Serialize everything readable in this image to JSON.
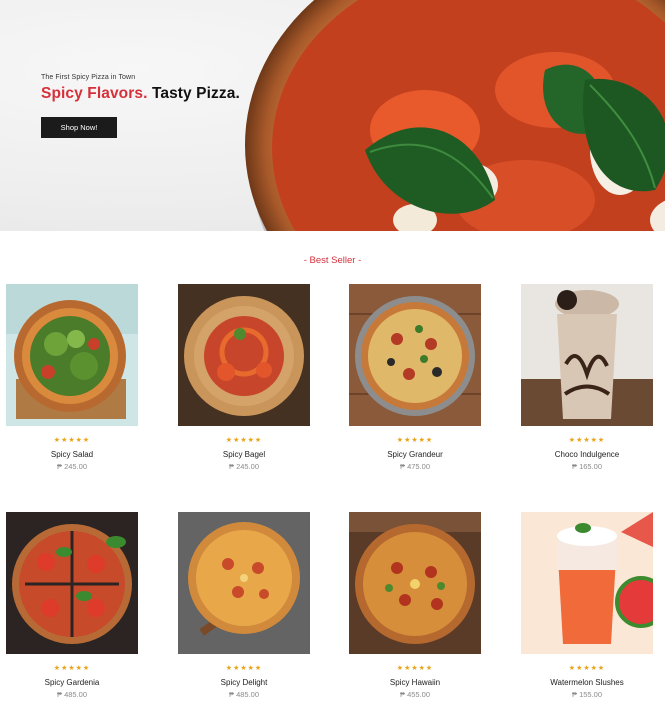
{
  "hero": {
    "tagline": "The First Spicy Pizza in Town",
    "headline_accent": "Spicy Flavors.",
    "headline_rest": "Tasty Pizza.",
    "cta_label": "Shop Now!"
  },
  "section": {
    "title": "- Best Seller -"
  },
  "products": [
    {
      "name": "Spicy Salad",
      "price": "₱ 245.00",
      "stars": "★★★★★",
      "rating": 5
    },
    {
      "name": "Spicy Bagel",
      "price": "₱ 245.00",
      "stars": "★★★★★",
      "rating": 5
    },
    {
      "name": "Spicy Grandeur",
      "price": "₱ 475.00",
      "stars": "★★★★★",
      "rating": 5
    },
    {
      "name": "Choco Indulgence",
      "price": "₱ 165.00",
      "stars": "★★★★★",
      "rating": 5
    },
    {
      "name": "Spicy Gardenia",
      "price": "₱ 485.00",
      "stars": "★★★★★",
      "rating": 5
    },
    {
      "name": "Spicy Delight",
      "price": "₱ 485.00",
      "stars": "★★★★★",
      "rating": 5
    },
    {
      "name": "Spicy Hawaiin",
      "price": "₱ 455.00",
      "stars": "★★★★★",
      "rating": 5
    },
    {
      "name": "Watermelon Slushes",
      "price": "₱ 155.00",
      "stars": "★★★★★",
      "rating": 5
    }
  ],
  "colors": {
    "accent": "#d6303a",
    "star": "#e8a317",
    "button": "#1b1b1b"
  }
}
